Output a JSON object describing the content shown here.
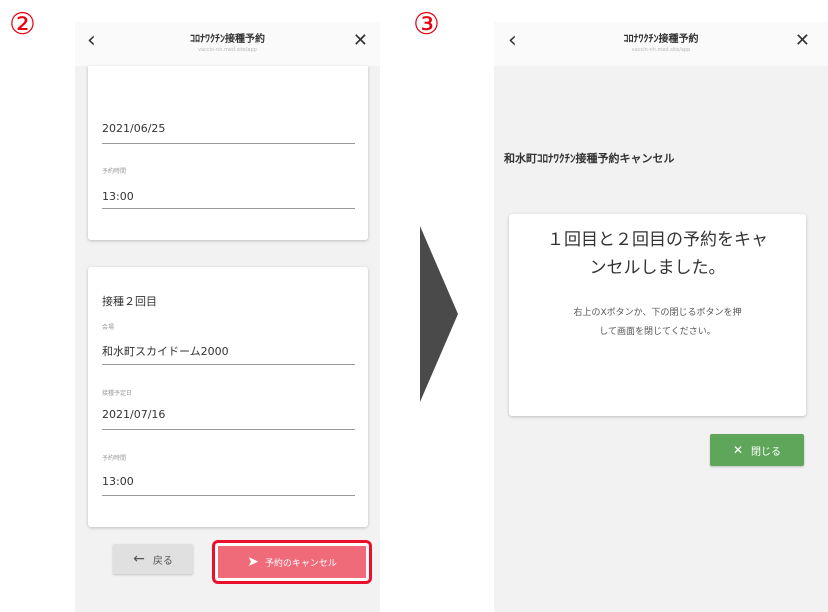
{
  "step_labels": {
    "left": "②",
    "right": "③"
  },
  "screen2": {
    "header": {
      "back_icon": "chevron-left",
      "title": "ｺﾛﾅﾜｸﾁﾝ接種予約",
      "url": "vaccin-nh.med.site/app",
      "close_icon": "x"
    },
    "card1": {
      "date_value": "2021/06/25",
      "time_label": "予約時間",
      "time_value": "13:00"
    },
    "card2": {
      "title": "接種２回目",
      "venue_label": "会場",
      "venue_value": "和水町スカイドーム2000",
      "date_label": "接種予定日",
      "date_value": "2021/07/16",
      "time_label": "予約時間",
      "time_value": "13:00"
    },
    "buttons": {
      "back_label": "戻る",
      "back_icon": "arrow-left",
      "cancel_label": "予約のキャンセル",
      "cancel_icon": "send"
    }
  },
  "screen3": {
    "header": {
      "back_icon": "chevron-left",
      "title": "ｺﾛﾅﾜｸﾁﾝ接種予約",
      "url": "vaccin-nh.med.site/app",
      "close_icon": "x"
    },
    "heading": "和水町ｺﾛﾅﾜｸﾁﾝ接種予約キャンセル",
    "message_main_1": "１回目と２回目の予約をキャ",
    "message_main_2": "ンセルしました。",
    "message_sub_1": "右上のXボタンか、下の閉じるボタンを押",
    "message_sub_2": "して画面を閉じてください。",
    "close_button_label": "閉じる",
    "close_button_icon": "x"
  },
  "colors": {
    "highlight": "#e8102c",
    "close_button": "#5fa65a",
    "arrow": "#4a4a4a"
  }
}
